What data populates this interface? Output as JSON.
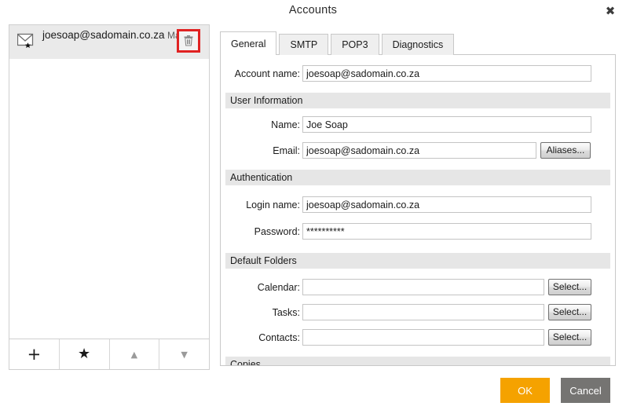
{
  "window": {
    "title": "Accounts",
    "close_label": "✖"
  },
  "accounts_panel": {
    "items": [
      {
        "email": "joesoap@sadomain.co.za",
        "type": "Mail",
        "icon": "envelope-star-icon",
        "delete_icon": "trash-icon"
      }
    ],
    "toolbar": [
      {
        "name": "add-account-button",
        "glyph": "+",
        "style": "plus"
      },
      {
        "name": "set-default-account-button",
        "glyph": "★",
        "style": "star"
      },
      {
        "name": "move-account-up-button",
        "glyph": "▲",
        "style": "arrow"
      },
      {
        "name": "move-account-down-button",
        "glyph": "▼",
        "style": "arrow"
      }
    ]
  },
  "tabs": [
    {
      "label": "General",
      "active": true
    },
    {
      "label": "SMTP",
      "active": false
    },
    {
      "label": "POP3",
      "active": false
    },
    {
      "label": "Diagnostics",
      "active": false
    }
  ],
  "general": {
    "account_name": {
      "label": "Account name:",
      "value": "joesoap@sadomain.co.za",
      "placeholder": ""
    },
    "user_information": {
      "header": "User Information",
      "name": {
        "label": "Name:",
        "value": "Joe Soap",
        "placeholder": ""
      },
      "email": {
        "label": "Email:",
        "value": "joesoap@sadomain.co.za",
        "placeholder": ""
      },
      "aliases_button": "Aliases..."
    },
    "authentication": {
      "header": "Authentication",
      "login_name": {
        "label": "Login name:",
        "value": "joesoap@sadomain.co.za",
        "placeholder": ""
      },
      "password": {
        "label": "Password:",
        "value": "**********",
        "placeholder": ""
      }
    },
    "default_folders": {
      "header": "Default Folders",
      "rows": [
        {
          "label": "Calendar:",
          "value": "",
          "placeholder": "",
          "button": "Select..."
        },
        {
          "label": "Tasks:",
          "value": "",
          "placeholder": "",
          "button": "Select..."
        },
        {
          "label": "Contacts:",
          "value": "",
          "placeholder": "",
          "button": "Select..."
        }
      ]
    },
    "copies": {
      "header": "Copies"
    }
  },
  "footer": {
    "ok_label": "OK",
    "cancel_label": "Cancel"
  },
  "colors": {
    "accent_ok": "#f5a200",
    "cancel": "#757472",
    "highlight_box": "#e02222",
    "section_header_bg": "#e6e6e6",
    "selected_row_bg": "#eaeaea"
  }
}
